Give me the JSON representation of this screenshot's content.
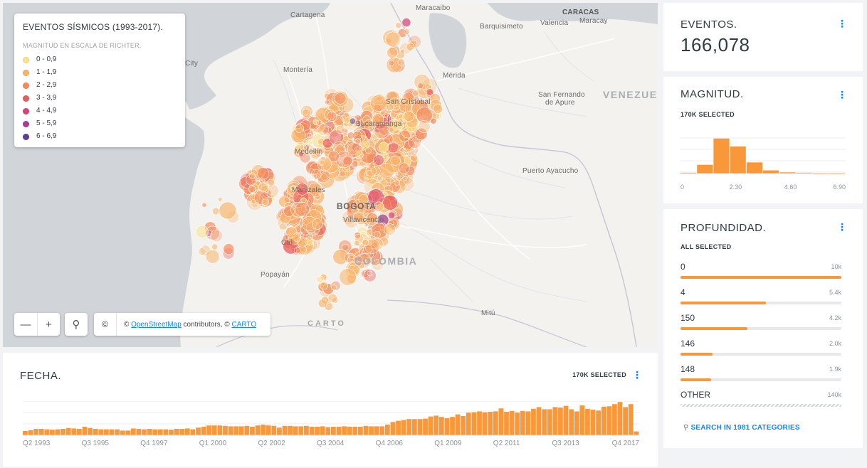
{
  "map": {
    "legend": {
      "title": "EVENTOS SÍSMICOS (1993-2017).",
      "subtitle": "MAGNITUD EN ESCALA DE RICHTER.",
      "items": [
        {
          "label": "0 - 0,9",
          "color": "#fce38a"
        },
        {
          "label": "1 - 1,9",
          "color": "#f9b46a"
        },
        {
          "label": "2 - 2,9",
          "color": "#f48a5c"
        },
        {
          "label": "3 - 3,9",
          "color": "#e85c5c"
        },
        {
          "label": "4 - 4,9",
          "color": "#d6457a"
        },
        {
          "label": "5 - 5,9",
          "color": "#a33e92"
        },
        {
          "label": "6 - 6,9",
          "color": "#5b3f94"
        }
      ]
    },
    "cities": {
      "cartagena": "Cartagena",
      "maracaibo": "Maracaibo",
      "caracas": "CARACAS",
      "maracay": "Maracay",
      "barquisimeto": "Barquisimeto",
      "valencia": "Valencia",
      "city": "City",
      "monteria": "Montería",
      "merida": "Mérida",
      "san_cristobal": "San Cristóbal",
      "san_fernando_1": "San Fernando",
      "san_fernando_2": "de Apure",
      "venezuela": "VENEZUEL",
      "bucaramanga": "Bucaramanga",
      "medellin": "Medellín",
      "puerto_ayacucho": "Puerto Ayacucho",
      "manizales": "Manizales",
      "bogota": "BOGOTA",
      "villavicencio": "Villavicencio",
      "cali": "Cali",
      "colombia": "COLOMBIA",
      "popayan": "Popayán",
      "mitu": "Mitú"
    },
    "controls": {
      "zoom_out": "—",
      "zoom_in": "+",
      "search_icon": "⚲",
      "copy_icon": "©",
      "attrib_prefix": "© ",
      "attrib_osm": "OpenStreetMap",
      "attrib_mid": " contributors, © ",
      "attrib_carto": "CARTO",
      "carto_logo": "CARTO"
    }
  },
  "fecha": {
    "title": "FECHA.",
    "selected": "170K SELECTED",
    "menu": "⋮",
    "x_labels": [
      "Q2 1993",
      "Q3 1995",
      "Q4 1997",
      "Q1 2000",
      "Q2 2002",
      "Q3 2004",
      "Q4 2006",
      "Q1 2009",
      "Q2 2011",
      "Q3 2013",
      "Q4 2017"
    ]
  },
  "eventos": {
    "title": "EVENTOS.",
    "value": "166,078",
    "menu": "⋮"
  },
  "magnitud": {
    "title": "MAGNITUD.",
    "selected": "170K SELECTED",
    "menu": "⋮",
    "x_labels": [
      "0",
      "2.30",
      "4.60",
      "6.90"
    ]
  },
  "profundidad": {
    "title": "PROFUNDIDAD.",
    "selected": "ALL SELECTED",
    "menu": "⋮",
    "categories": [
      {
        "name": "0",
        "count": "10k",
        "fraction": 1.0
      },
      {
        "name": "4",
        "count": "5.4k",
        "fraction": 0.53
      },
      {
        "name": "150",
        "count": "4.2k",
        "fraction": 0.415
      },
      {
        "name": "146",
        "count": "2.0k",
        "fraction": 0.2
      },
      {
        "name": "148",
        "count": "1.9k",
        "fraction": 0.19
      },
      {
        "name": "OTHER",
        "count": "140k",
        "fraction": 1.0,
        "hatched": true
      }
    ],
    "search_label": "SEARCH IN 1981 CATEGORIES"
  },
  "chart_data": [
    {
      "type": "bar",
      "name": "FECHA.",
      "x_range": [
        "1993",
        "2017"
      ],
      "tick_labels": [
        "Q2 1993",
        "Q3 1995",
        "Q4 1997",
        "Q1 2000",
        "Q2 2002",
        "Q3 2004",
        "Q4 2006",
        "Q1 2009",
        "Q2 2011",
        "Q3 2013",
        "Q4 2017"
      ],
      "values": [
        10,
        12,
        15,
        15,
        14,
        13,
        14,
        15,
        17,
        16,
        15,
        20,
        17,
        15,
        14,
        14,
        14,
        14,
        11,
        11,
        16,
        15,
        14,
        15,
        14,
        14,
        14,
        13,
        15,
        15,
        16,
        14,
        18,
        20,
        23,
        23,
        23,
        22,
        21,
        21,
        21,
        22,
        20,
        23,
        25,
        23,
        22,
        18,
        22,
        22,
        21,
        21,
        22,
        20,
        20,
        21,
        19,
        20,
        20,
        21,
        20,
        20,
        20,
        22,
        21,
        21,
        21,
        25,
        31,
        34,
        36,
        38,
        38,
        38,
        39,
        44,
        46,
        43,
        40,
        43,
        49,
        45,
        53,
        54,
        56,
        54,
        55,
        56,
        63,
        55,
        57,
        53,
        57,
        56,
        62,
        66,
        61,
        61,
        66,
        65,
        69,
        61,
        56,
        70,
        62,
        60,
        58,
        67,
        68,
        73,
        78,
        66,
        73,
        9
      ],
      "ylim": [
        0,
        80
      ]
    },
    {
      "type": "bar",
      "name": "MAGNITUD.",
      "xlim": [
        0,
        6.9
      ],
      "tick_labels": [
        "0",
        "2.30",
        "4.60",
        "6.90"
      ],
      "bins": [
        0,
        0.69,
        1.38,
        2.07,
        2.76,
        3.45,
        4.14,
        4.83,
        5.52,
        6.21
      ],
      "values": [
        2,
        22,
        88,
        68,
        28,
        8,
        3,
        2,
        1,
        1
      ],
      "ylim": [
        0,
        100
      ]
    },
    {
      "type": "bar",
      "name": "PROFUNDIDAD.",
      "categories": [
        "0",
        "4",
        "150",
        "146",
        "148",
        "OTHER"
      ],
      "values": [
        10000,
        5400,
        4200,
        2000,
        1900,
        140000
      ]
    }
  ]
}
